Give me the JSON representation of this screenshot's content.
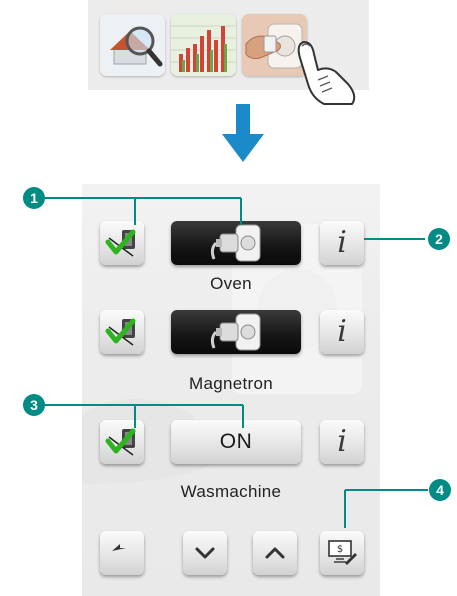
{
  "colors": {
    "callout": "#008b84",
    "arrow": "#1b8ac9",
    "check": "#2fb321"
  },
  "devices": [
    {
      "name": "Oven",
      "state_label": "",
      "state": "icon",
      "dark": true
    },
    {
      "name": "Magnetron",
      "state_label": "",
      "state": "icon",
      "dark": true
    },
    {
      "name": "Wasmachine",
      "state_label": "ON",
      "state": "text",
      "dark": false
    }
  ],
  "info_label": "i",
  "callouts": [
    "1",
    "2",
    "3",
    "4"
  ],
  "icons": {
    "thumbnails": [
      "magnifier-house-icon",
      "bar-chart-icon",
      "plug-hand-icon"
    ],
    "row_left": "checkmark-socket-icon",
    "plug": "plug-socket-icon",
    "nav": [
      "back-arrow-icon",
      "chevron-down-icon",
      "chevron-up-icon",
      "cost-monitor-icon"
    ]
  }
}
